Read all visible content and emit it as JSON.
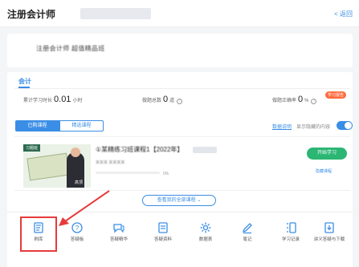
{
  "header": {
    "title": "注册会计师",
    "back_label": "< 返回"
  },
  "banner": {
    "text": "注册会计师 超值精品班"
  },
  "subject": {
    "title": "会计"
  },
  "stats": {
    "study_time_label": "累计学习时长",
    "study_time_value": "0.01",
    "study_time_unit": "小时",
    "questions_label": "做题总数",
    "questions_value": "0",
    "questions_unit": "道",
    "accuracy_label": "做题正确率",
    "accuracy_value": "0",
    "accuracy_unit": "%",
    "badge": "学习报告"
  },
  "tabs": [
    {
      "label": "已购课程"
    },
    {
      "label": "精选课程"
    }
  ],
  "options": {
    "analysis_link": "数据说明",
    "show_hidden_label": "显示隐藏的内容"
  },
  "course": {
    "tag": "习题班",
    "title": "①某精练习班课程1【2022年】",
    "meta": "某某某   某某某某",
    "teacher_name": "高顶",
    "progress_text": "0%",
    "progress": 0,
    "start_label": "开始学习",
    "hide_label": "隐藏课程"
  },
  "more_courses_label": "查看我的全部课程",
  "tools": [
    {
      "label": "刷库",
      "icon": "question-bank-icon"
    },
    {
      "label": "答疑板",
      "icon": "qa-board-icon"
    },
    {
      "label": "答疑精华",
      "icon": "qa-highlights-icon"
    },
    {
      "label": "答疑资料",
      "icon": "qa-materials-icon"
    },
    {
      "label": "数据表",
      "icon": "gear-data-icon"
    },
    {
      "label": "笔记",
      "icon": "notes-icon"
    },
    {
      "label": "学习记录",
      "icon": "study-record-icon"
    },
    {
      "label": "讲义答疑与下载",
      "icon": "download-icon"
    }
  ],
  "colors": {
    "accent": "#3a8ee6",
    "start_button": "#2bb673",
    "highlight": "#e63b3b",
    "badge": "#ff6a3d"
  }
}
